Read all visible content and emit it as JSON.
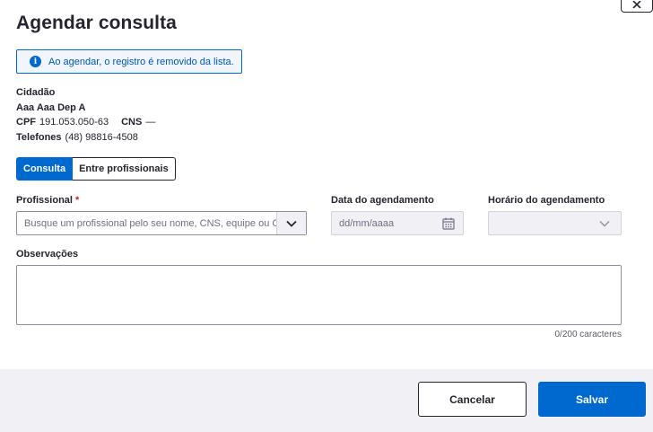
{
  "modal": {
    "title": "Agendar consulta",
    "close_icon": "close-icon"
  },
  "alert": {
    "icon": "info-icon",
    "text": "Ao agendar, o registro é removido da lista."
  },
  "cidadao": {
    "section_label": "Cidadão",
    "name": "Aaa Aaa Dep A",
    "cpf_label": "CPF",
    "cpf_value": "191.053.050-63",
    "cns_label": "CNS",
    "cns_value": "—",
    "phones_label": "Telefones",
    "phones_value": "(48) 98816-4508"
  },
  "tabs": [
    {
      "label": "Consulta",
      "active": true
    },
    {
      "label": "Entre profissionais",
      "active": false
    }
  ],
  "form": {
    "profissional": {
      "label": "Profissional",
      "required_mark": "*",
      "placeholder": "Busque um profissional pelo seu nome, CNS, equipe ou C"
    },
    "data": {
      "label": "Data do agendamento",
      "placeholder": "dd/mm/aaaa"
    },
    "horario": {
      "label": "Horário do agendamento",
      "value": ""
    },
    "observacoes": {
      "label": "Observações",
      "counter": "0/200 caracteres"
    }
  },
  "footer": {
    "cancel_label": "Cancelar",
    "save_label": "Salvar"
  },
  "colors": {
    "primary": "#0069d0",
    "required": "#d01e1e",
    "footer_bg": "#f0f0f5"
  }
}
